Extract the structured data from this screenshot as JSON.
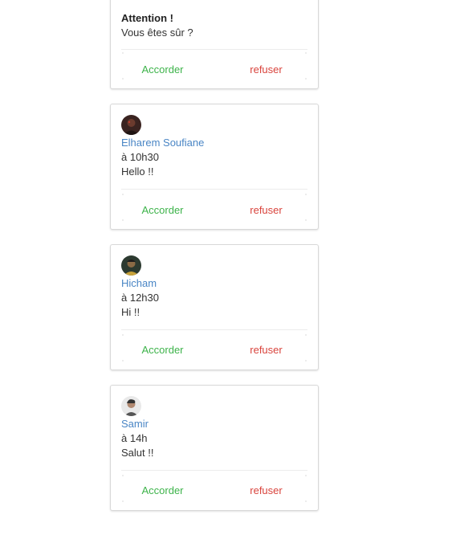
{
  "alert": {
    "title": "Attention !",
    "message": "Vous êtes sûr ?",
    "accept_label": "Accorder",
    "refuse_label": "refuser"
  },
  "requests": [
    {
      "name": "Elharem Soufiane",
      "time": "à 10h30",
      "message": "Hello !!",
      "accept_label": "Accorder",
      "refuse_label": "refuser",
      "avatar": "user-photo-icon"
    },
    {
      "name": "Hicham",
      "time": "à 12h30",
      "message": "Hi !!",
      "accept_label": "Accorder",
      "refuse_label": "refuser",
      "avatar": "user-photo-icon"
    },
    {
      "name": "Samir",
      "time": "à 14h",
      "message": "Salut !!",
      "accept_label": "Accorder",
      "refuse_label": "refuser",
      "avatar": "user-photo-icon"
    }
  ],
  "colors": {
    "accept": "#3db34a",
    "refuse": "#d9443d",
    "link": "#4a86c5"
  }
}
